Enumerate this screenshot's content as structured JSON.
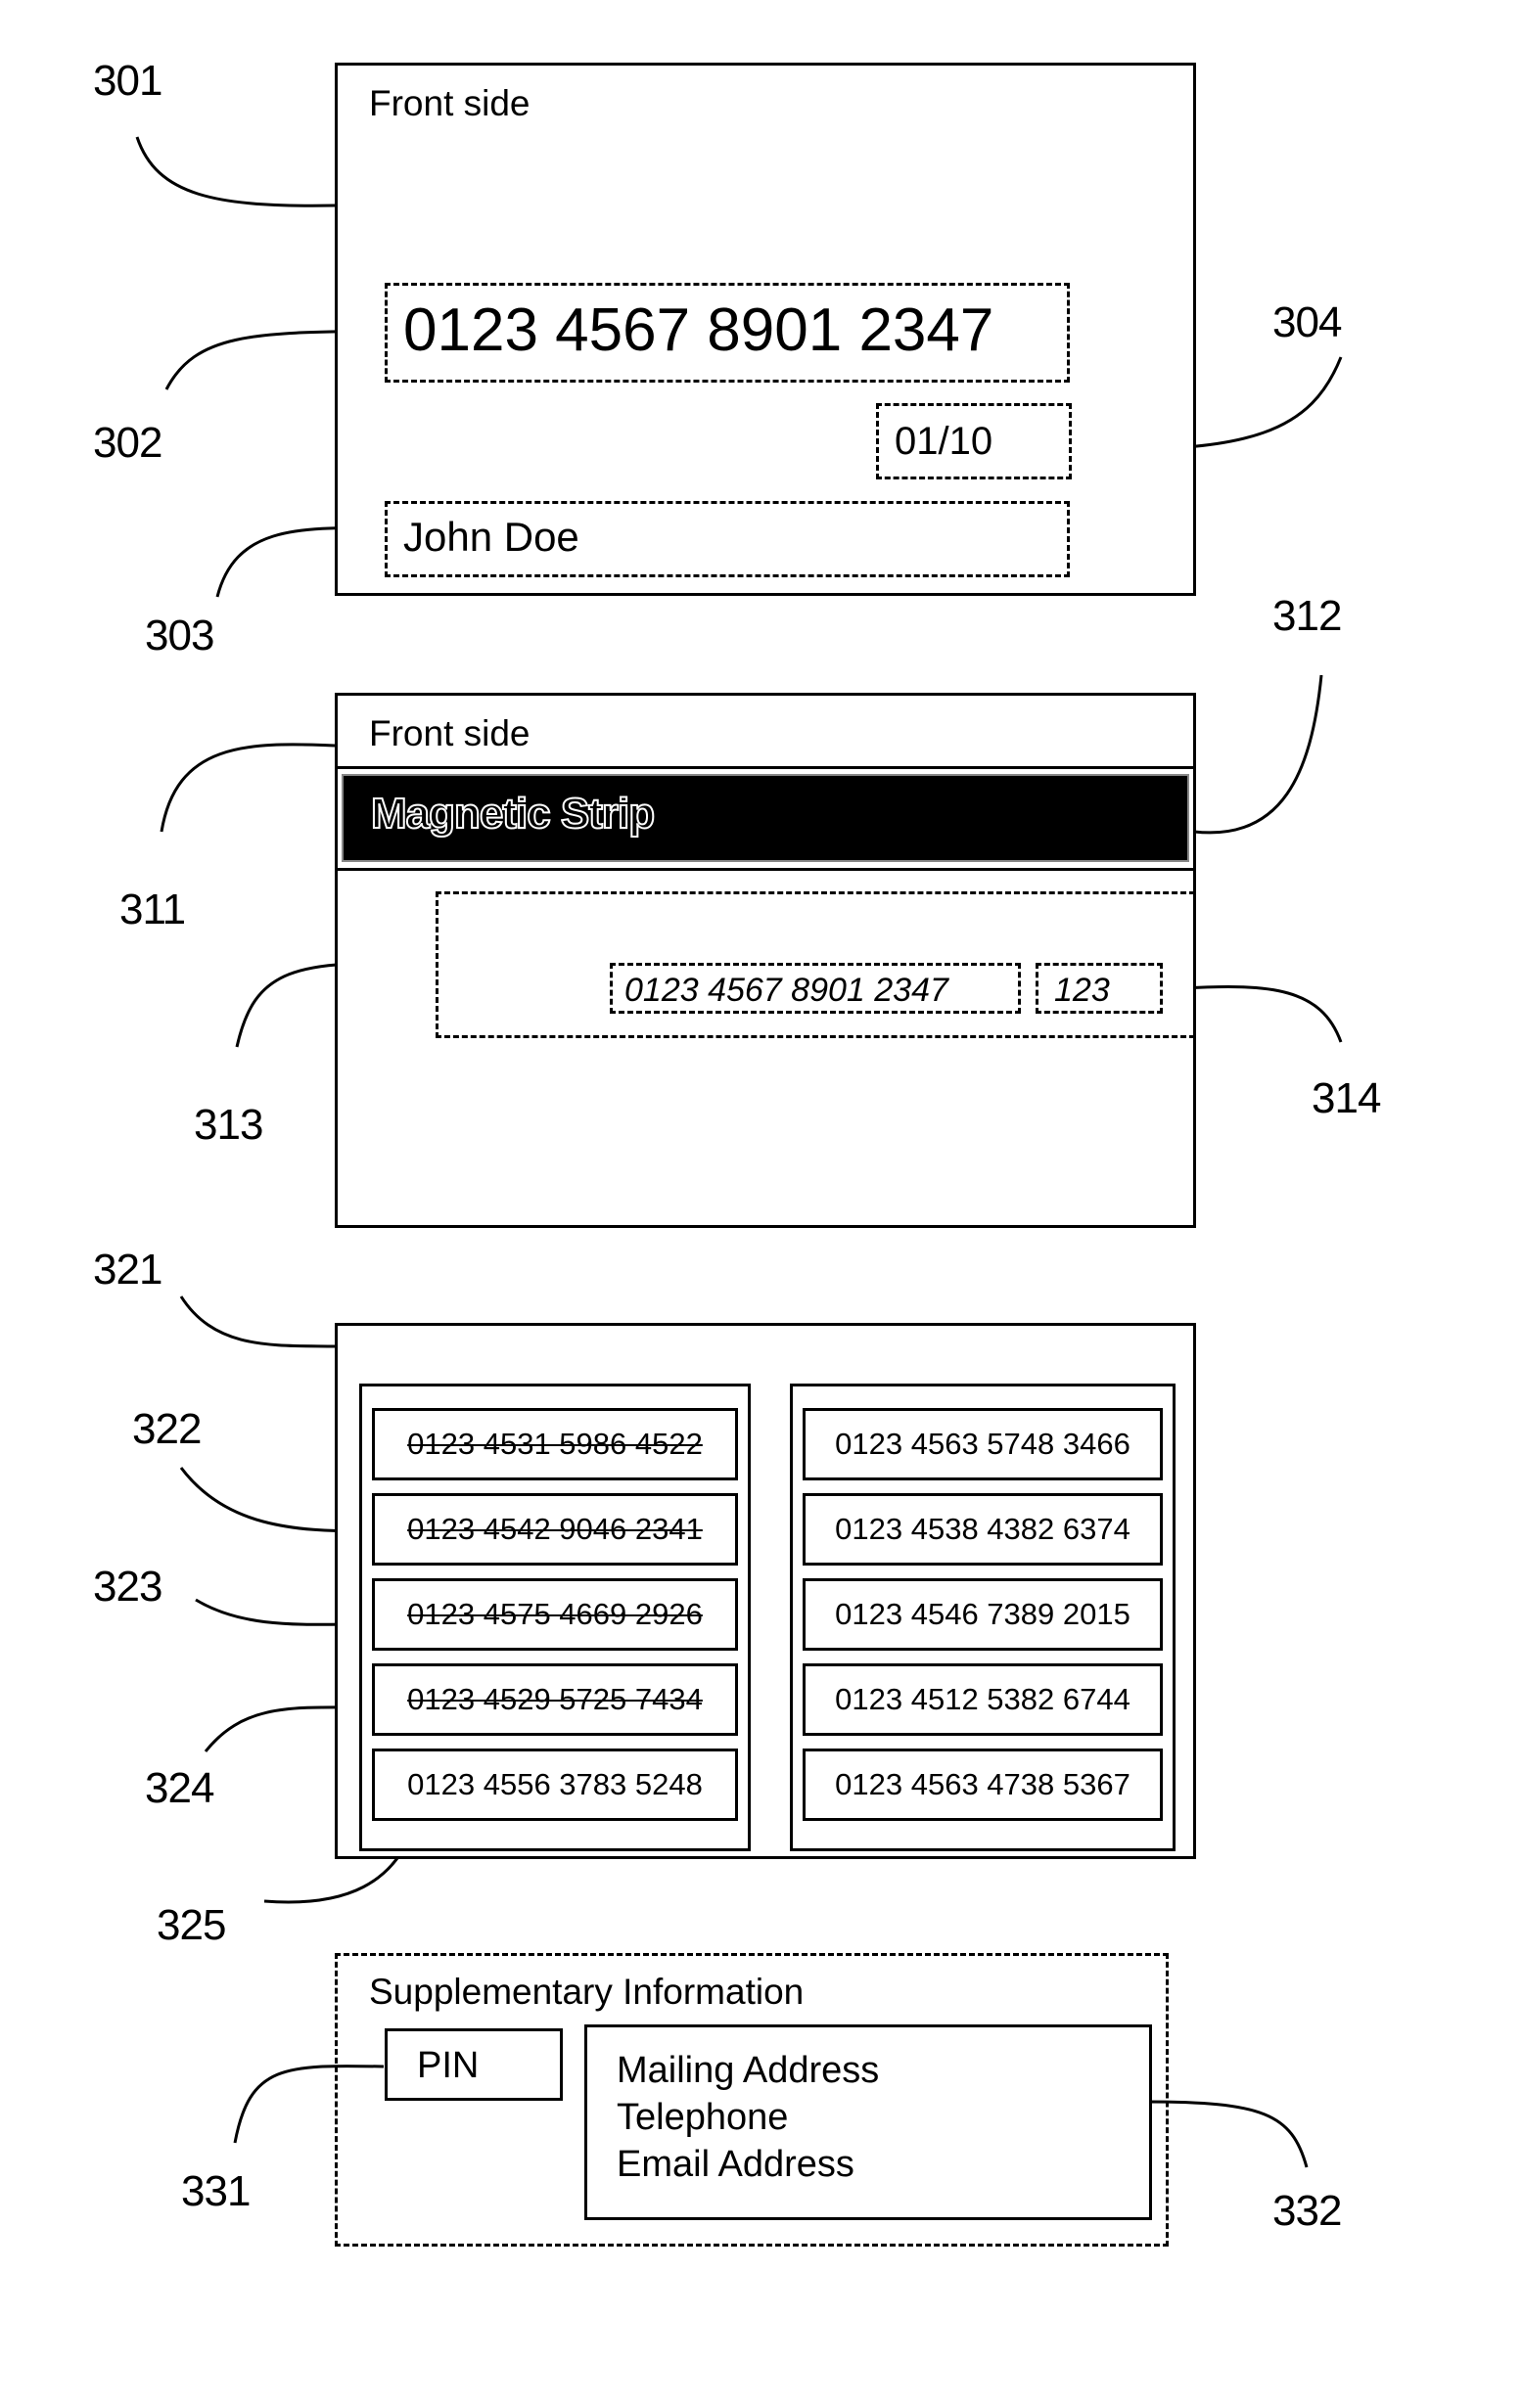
{
  "refs": {
    "r301": "301",
    "r302": "302",
    "r303": "303",
    "r304": "304",
    "r311": "311",
    "r312": "312",
    "r313": "313",
    "r314": "314",
    "r321": "321",
    "r322": "322",
    "r323": "323",
    "r324": "324",
    "r325": "325",
    "r331": "331",
    "r332": "332"
  },
  "card_front": {
    "title": "Front side",
    "card_number": "0123 4567 8901 2347",
    "expiry": "01/10",
    "holder_name": "John Doe"
  },
  "card_back": {
    "title": "Front side",
    "strip_label": "Magnetic Strip",
    "card_number": "0123 4567 8901 2347",
    "cvv": "123"
  },
  "number_list": {
    "left_column": [
      {
        "number": "0123 4531 5986 4522",
        "struck": true
      },
      {
        "number": "0123 4542 9046 2341",
        "struck": true
      },
      {
        "number": "0123 4575 4669 2926",
        "struck": true
      },
      {
        "number": "0123 4529 5725 7434",
        "struck": true
      },
      {
        "number": "0123 4556 3783 5248",
        "struck": false
      }
    ],
    "right_column": [
      {
        "number": "0123 4563 5748 3466",
        "struck": false
      },
      {
        "number": "0123 4538 4382 6374",
        "struck": false
      },
      {
        "number": "0123 4546 7389 2015",
        "struck": false
      },
      {
        "number": "0123 4512 5382 6744",
        "struck": false
      },
      {
        "number": "0123 4563 4738 5367",
        "struck": false
      }
    ]
  },
  "supplementary": {
    "title": "Supplementary Information",
    "pin_label": "PIN",
    "contact_lines": [
      "Mailing Address",
      "Telephone",
      "Email Address"
    ]
  }
}
